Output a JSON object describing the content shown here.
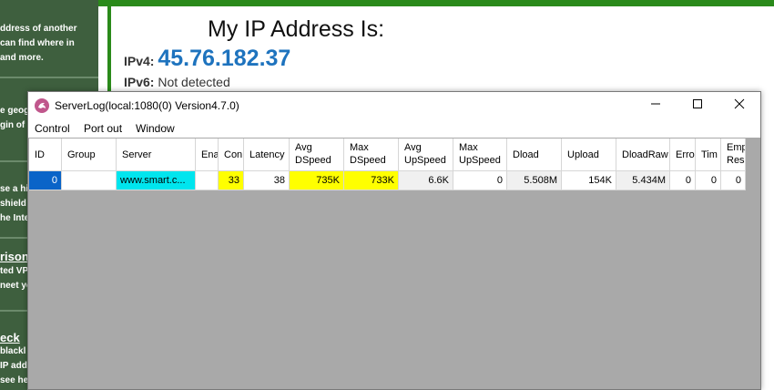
{
  "background_page": {
    "sidebar_blocks": [
      {
        "lines": [
          "ddress of another",
          "can find where in",
          "and more."
        ]
      },
      {
        "lines": [
          "e geogr",
          "gin of"
        ]
      },
      {
        "lines": [
          "se a hi",
          "shield",
          "he Inte"
        ]
      },
      {
        "heading": "rison",
        "lines": [
          "ted VP",
          "neet yo"
        ]
      },
      {
        "heading": "eck",
        "lines": [
          "blackl",
          "IP add",
          "see he"
        ]
      }
    ],
    "title": "My IP Address Is:",
    "ipv4_label": "IPv4:",
    "ipv4_value": "45.76.182.37",
    "ipv6_label": "IPv6:",
    "ipv6_value": "Not detected"
  },
  "window": {
    "title": "ServerLog(local:1080(0) Version4.7.0)",
    "controls": {
      "minimize": "minimize-icon",
      "maximize": "maximize-icon",
      "close": "close-icon"
    },
    "menu": [
      "Control",
      "Port out",
      "Window"
    ]
  },
  "grid": {
    "columns": [
      "ID",
      "Group",
      "Server",
      "Ena",
      "Con",
      "Latency",
      "Avg DSpeed",
      "Max DSpeed",
      "Avg UpSpeed",
      "Max UpSpeed",
      "Dload",
      "Upload",
      "DloadRaw",
      "Erro",
      "Tim",
      "Emp Res"
    ],
    "rows": [
      {
        "cells": [
          "0",
          "",
          "www.smart.c...",
          "",
          "33",
          "38",
          "735K",
          "733K",
          "6.6K",
          "0",
          "5.508M",
          "154K",
          "5.434M",
          "0",
          "0",
          "0"
        ]
      }
    ]
  },
  "colors": {
    "selected_id": "#0a64c8",
    "server_cell": "#00e5ee",
    "highlight": "#ffff00",
    "sidebar": "#3e5f3e",
    "frame": "#2a8a1a",
    "ip_value": "#1e73be",
    "app_icon": "#c0578c"
  }
}
